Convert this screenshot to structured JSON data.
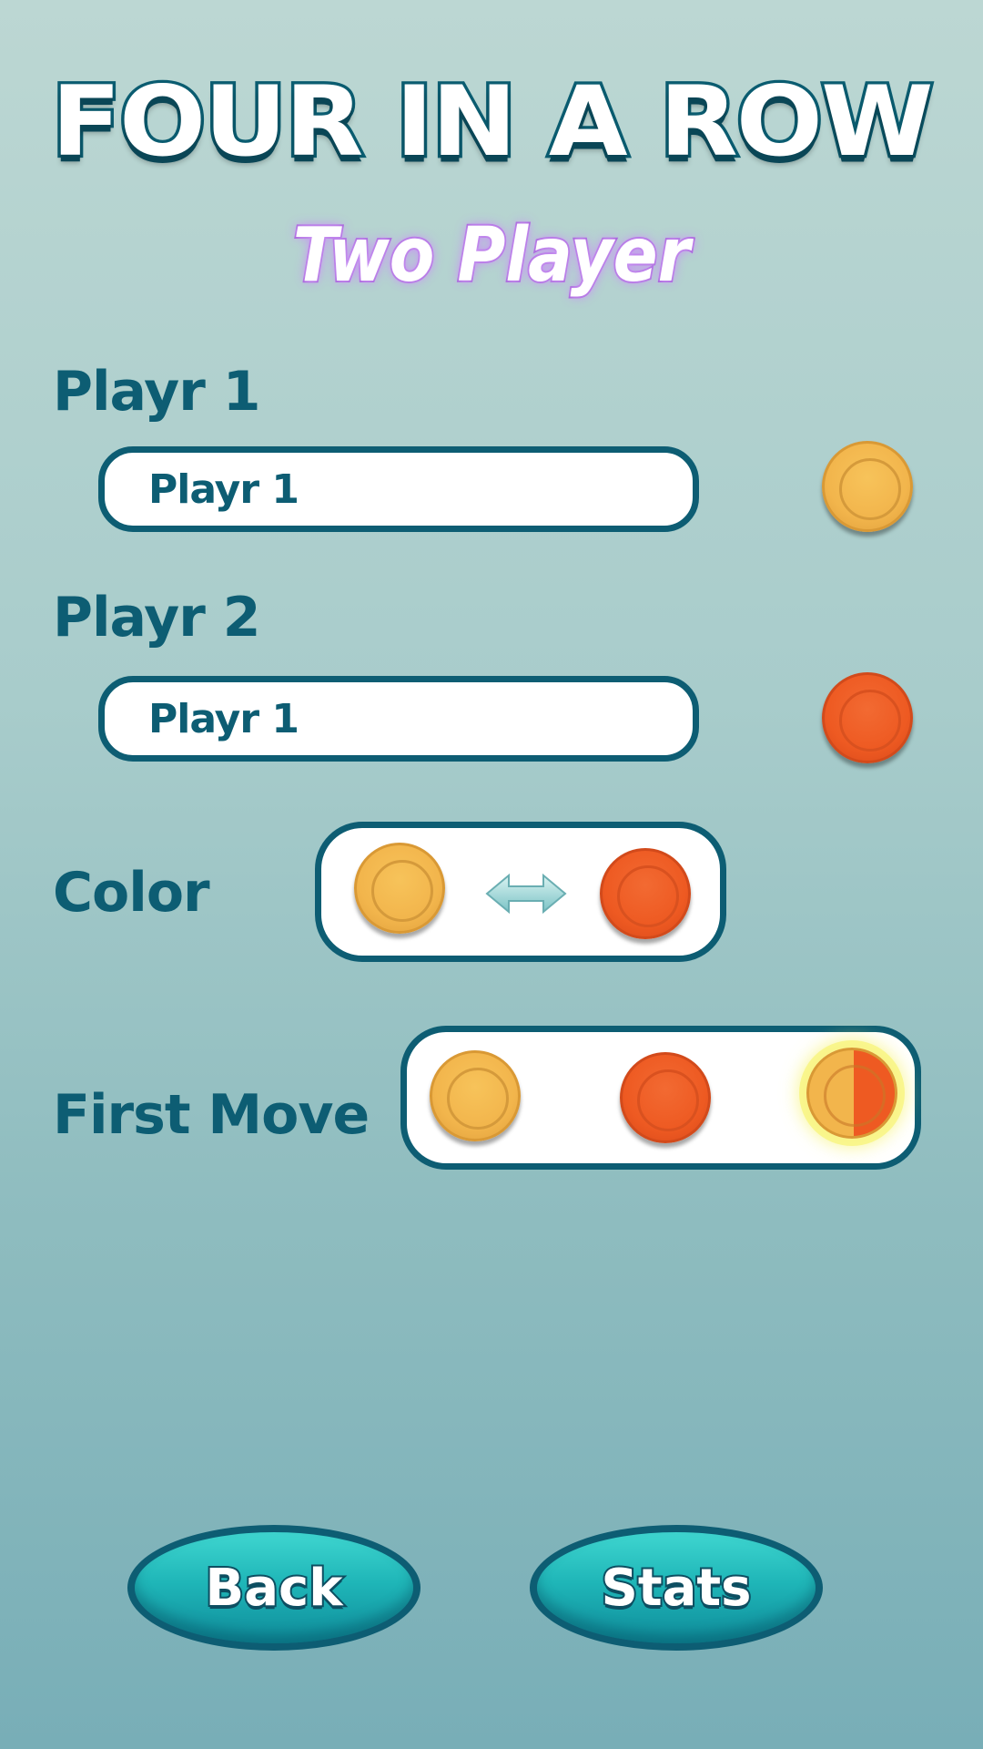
{
  "header": {
    "title": "FOUR IN A ROW",
    "subtitle": "Two Player"
  },
  "player1": {
    "label": "Playr 1",
    "name_value": "Playr 1",
    "chip_color": "#f2b54c"
  },
  "player2": {
    "label": "Playr 2",
    "name_value": "Playr 1",
    "chip_color": "#ee5a22"
  },
  "color_option": {
    "label": "Color",
    "left_chip": "yellow",
    "right_chip": "red",
    "swap_icon": "double-arrow-icon"
  },
  "first_move": {
    "label": "First Move",
    "options": [
      "yellow",
      "red",
      "random"
    ],
    "selected": "random"
  },
  "buttons": {
    "back_label": "Back",
    "stats_label": "Stats"
  },
  "colors": {
    "accent": "#0d5d73",
    "yellow": "#f2b54c",
    "red": "#ee5a22",
    "subtitle_glow": "#a25ad6",
    "button": "#1fb6b8"
  }
}
